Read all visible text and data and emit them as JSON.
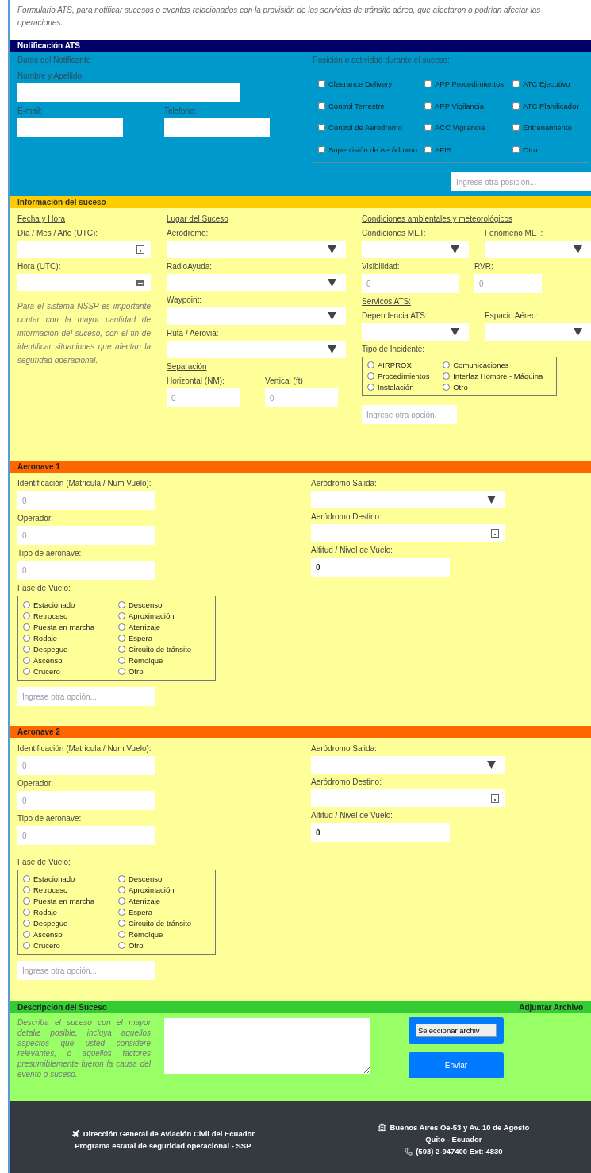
{
  "intro": "Formulario ATS, para notificar sucesos o eventos relacionados con la provisión de los servicios de tránsito aéreo, que afectaron o podrían afectar las operaciones.",
  "notification": {
    "title": "Notificación ATS",
    "notifier_heading": "Datos del Notificante",
    "name_label": "Nombre y Apellido:",
    "email_label": "E-mail:",
    "phone_label": "Telefono:",
    "position_heading": "Posición o actividad durante el suceso:",
    "positions": [
      {
        "label": "Clearance Delivery",
        "checked": false
      },
      {
        "label": "APP Procedimientos",
        "checked": false
      },
      {
        "label": "ATC Ejecutivo",
        "checked": false
      },
      {
        "label": "Control Terrestre",
        "checked": false
      },
      {
        "label": "APP Vigilancia",
        "checked": false
      },
      {
        "label": "ATC Planificador",
        "checked": false
      },
      {
        "label": "Control de Aeródromo",
        "checked": false
      },
      {
        "label": "ACC Vigilancia",
        "checked": false
      },
      {
        "label": "Entrenamiento",
        "checked": false
      },
      {
        "label": "Supervisión de Aeródromo",
        "checked": false
      },
      {
        "label": "AFIS",
        "checked": false
      },
      {
        "label": "Otro",
        "checked": false
      }
    ],
    "other_position_placeholder": "Ingrese otra posición..."
  },
  "event": {
    "title": "Información del suceso",
    "columns": [
      {
        "rows": [
          [
            {
              "kind": "heading",
              "text": "Fecha y Hora"
            }
          ],
          [
            {
              "kind": "date",
              "label": "Día / Mes / Año (UTC):"
            }
          ],
          [
            {
              "kind": "time",
              "label": "Hora (UTC):"
            }
          ],
          [
            {
              "kind": "note",
              "text": "Para el sistema NSSP es importante contar con la mayor cantidad de información del suceso, con el fin de identificar situaciones que afectan la seguridad operacional."
            }
          ]
        ]
      },
      {
        "rows": [
          [
            {
              "kind": "heading",
              "text": "Lugar del Suceso"
            }
          ],
          [
            {
              "kind": "select",
              "label": "Aeródromo:"
            }
          ],
          [
            {
              "kind": "select",
              "label": "RadioAyuda:"
            }
          ],
          [
            {
              "kind": "select",
              "label": "Waypoint:"
            }
          ],
          [
            {
              "kind": "select",
              "label": "Ruta / Aerovia:"
            }
          ],
          [
            {
              "kind": "heading",
              "text": "Separación"
            }
          ],
          [
            {
              "kind": "text",
              "label": "Horizontal (NM):",
              "placeholder": "0"
            },
            {
              "kind": "text",
              "label": "Vertical (ft)",
              "placeholder": "0"
            }
          ]
        ]
      },
      {
        "rows": [
          [
            {
              "kind": "heading",
              "text": "Condiciones ambientales y meteorológicos"
            }
          ],
          [
            {
              "kind": "select",
              "label": "Condiciones MET:"
            },
            {
              "kind": "select",
              "label": "Fenómeno MET:"
            }
          ],
          [
            {
              "kind": "text",
              "label": "Visibilidad:",
              "placeholder": "0"
            },
            {
              "kind": "text",
              "label": "RVR:",
              "placeholder": "0"
            }
          ],
          [
            {
              "kind": "heading",
              "text": "Servicos ATS:"
            }
          ],
          [
            {
              "kind": "select",
              "label": "Dependencia ATS:"
            },
            {
              "kind": "select",
              "label": "Espacio Aéreo:"
            }
          ],
          [
            {
              "kind": "radios",
              "label": "Tipo de Incidente:",
              "options": [
                {
                  "label": "AIRPROX",
                  "selected": false
                },
                {
                  "label": "Comunicaciones",
                  "selected": false
                },
                {
                  "label": "Procedimientos",
                  "selected": false
                },
                {
                  "label": "Interfaz Hombre - Máquina",
                  "selected": false
                },
                {
                  "label": "Instalación",
                  "selected": false
                },
                {
                  "label": "Otro",
                  "selected": false
                }
              ]
            }
          ],
          [
            {
              "kind": "text",
              "placeholder": "Ingrese otra opción."
            }
          ]
        ]
      }
    ]
  },
  "aircraft": [
    {
      "title": "Aeronave 1",
      "id_label": "Identificación (Matricula / Num Vuelo):",
      "id_placeholder": "0",
      "operator_label": "Operador:",
      "operator_placeholder": "0",
      "type_label": "Tipo de aeronave:",
      "type_placeholder": "0",
      "phase_label": "Fase de Vuelo:",
      "phases": [
        {
          "label": "Estacionado",
          "selected": false
        },
        {
          "label": "Retroceso",
          "selected": false
        },
        {
          "label": "Puesta en marcha",
          "selected": false
        },
        {
          "label": "Rodaje",
          "selected": false
        },
        {
          "label": "Despegue",
          "selected": false
        },
        {
          "label": "Ascenso",
          "selected": false
        },
        {
          "label": "Crucero",
          "selected": false
        },
        {
          "label": "Descenso",
          "selected": false
        },
        {
          "label": "Aproximación",
          "selected": false
        },
        {
          "label": "Aterrizaje",
          "selected": false
        },
        {
          "label": "Espera",
          "selected": false
        },
        {
          "label": "Circuito de tránsito",
          "selected": false
        },
        {
          "label": "Remolque",
          "selected": false
        },
        {
          "label": "Otro",
          "selected": false
        }
      ],
      "other_placeholder": "Ingrese otra opción...",
      "departure_label": "Aeródromo Salida:",
      "destination_label": "Aeródromo Destino:",
      "altitude_label": "Altitud / Nivel de Vuelo:",
      "altitude_value": "0"
    },
    {
      "title": "Aeronave 2",
      "id_label": "Identificación (Matricula / Num Vuelo):",
      "id_placeholder": "0",
      "operator_label": "Operador:",
      "operator_placeholder": "0",
      "type_label": "Tipo de aeronave:",
      "type_placeholder": "0",
      "phase_label": "Fase de Vuelo:",
      "phases": [
        {
          "label": "Estacionado",
          "selected": false
        },
        {
          "label": "Retroceso",
          "selected": false
        },
        {
          "label": "Puesta en marcha",
          "selected": false
        },
        {
          "label": "Rodaje",
          "selected": false
        },
        {
          "label": "Despegue",
          "selected": false
        },
        {
          "label": "Ascenso",
          "selected": false
        },
        {
          "label": "Crucero",
          "selected": false
        },
        {
          "label": "Descenso",
          "selected": false
        },
        {
          "label": "Aproximación",
          "selected": false
        },
        {
          "label": "Aterrizaje",
          "selected": false
        },
        {
          "label": "Espera",
          "selected": false
        },
        {
          "label": "Circuito de tránsito",
          "selected": false
        },
        {
          "label": "Remolque",
          "selected": false
        },
        {
          "label": "Otro",
          "selected": false
        }
      ],
      "other_placeholder": "Ingrese otra opción...",
      "departure_label": "Aeródromo Salida:",
      "destination_label": "Aeródromo Destino:",
      "altitude_label": "Altitud / Nivel de Vuelo:",
      "altitude_value": "0"
    }
  ],
  "description": {
    "title": "Descripción del Suceso",
    "attach_title": "Adjuntar Archivo",
    "hint": "Describa el suceso con el mayor detalle posible, incluya aquellos aspectos que usted considere relevantes, o aquellos factores presumiblemente fueron la causa del evento o suceso.",
    "file_button": "Seleccionar archiv",
    "submit_button": "Enviar"
  },
  "footer": {
    "org": "Dirección General de Aviación Civil del Ecuador",
    "program": "Programa estatal de seguridad operacional - SSP",
    "address": "Buenos Aires Oe-53 y Av. 10 de Agosto",
    "city": "Quito - Ecuador",
    "phone": "(593) 2-947400 Ext: 4830"
  }
}
